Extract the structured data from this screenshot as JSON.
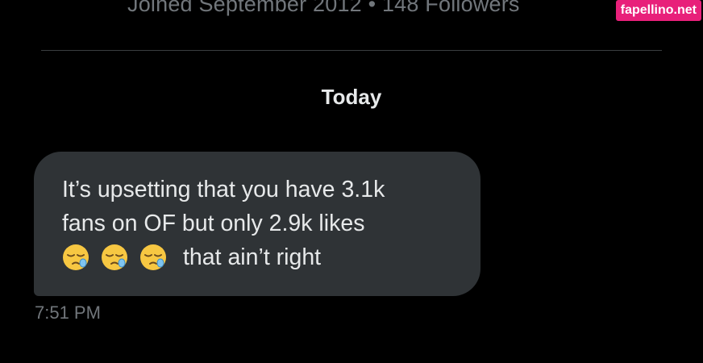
{
  "profile": {
    "meta": "Joined September 2012 • 148 Followers"
  },
  "watermark": "fapellino.net",
  "conversation": {
    "day_label": "Today",
    "message": {
      "line1": "It’s upsetting that you have 3.1k",
      "line2": "fans on OF but only 2.9k likes",
      "emoji_count": 3,
      "emoji_name": "sleepy-face",
      "line3_text": "that ain’t right",
      "time": "7:51 PM"
    }
  },
  "colors": {
    "background": "#000000",
    "bubble": "#2f3336",
    "text": "#e7e9ea",
    "muted": "#71767b",
    "watermark": "#e8207a"
  }
}
